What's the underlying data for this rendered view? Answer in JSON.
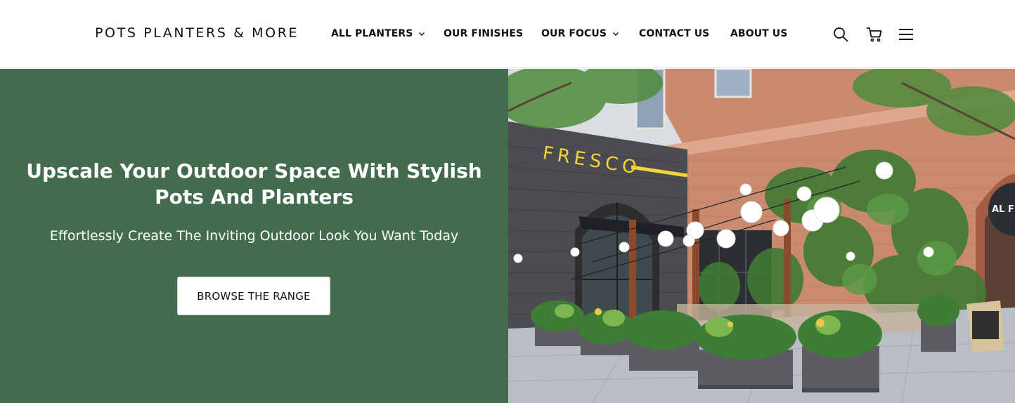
{
  "brand": {
    "logo_text": "POTS PLANTERS & MORE"
  },
  "nav": {
    "items": [
      {
        "label": "ALL PLANTERS",
        "has_dropdown": true
      },
      {
        "label": "OUR FINISHES",
        "has_dropdown": false
      },
      {
        "label": "OUR FOCUS",
        "has_dropdown": true
      },
      {
        "label": "CONTACT US",
        "has_dropdown": false
      },
      {
        "label": "ABOUT US",
        "has_dropdown": false
      }
    ]
  },
  "header_icons": [
    "search-icon",
    "cart-icon",
    "menu-icon"
  ],
  "hero": {
    "title": "Upscale Your Outdoor Space With Stylish Pots And Planters",
    "subtitle": "Effortlessly Create The Inviting Outdoor Look You Want Today",
    "cta_label": "BROWSE THE RANGE",
    "image": {
      "storefront_sign": "FRESCO",
      "side_sign": "AL FR"
    }
  },
  "colors": {
    "hero_panel": "#436c4e",
    "text_dark": "#111111",
    "sign_yellow": "#f2d43a"
  }
}
